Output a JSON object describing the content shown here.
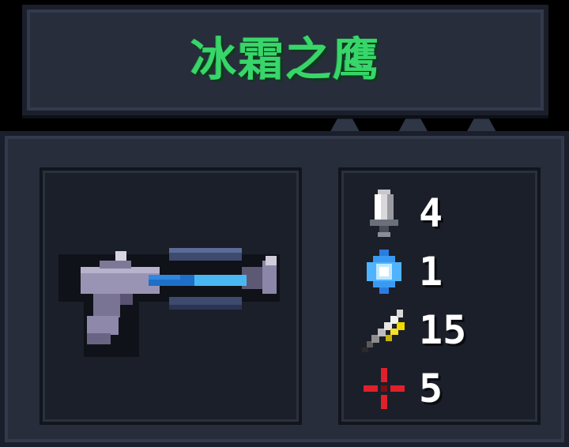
{
  "title": "冰霜之鹰",
  "colors": {
    "title": "#38d66a",
    "panel": "#272d3b",
    "slot": "#1b1f29"
  },
  "weapon": {
    "icon": "frost-hawk-blaster-icon"
  },
  "stats": [
    {
      "icon": "damage-sword-icon",
      "value": "4"
    },
    {
      "icon": "energy-crystal-icon",
      "value": "1"
    },
    {
      "icon": "crit-feather-icon",
      "value": "15"
    },
    {
      "icon": "accuracy-crosshair-icon",
      "value": "5"
    }
  ]
}
